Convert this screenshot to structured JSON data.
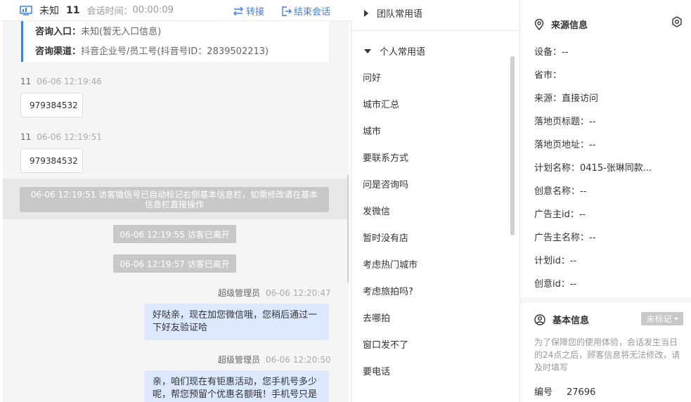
{
  "header": {
    "visitor_label": "未知",
    "visitor_num": "11",
    "timer_label": "会话时间：",
    "timer_value": "00:00:09",
    "transfer_label": "转接",
    "end_label": "结束会话"
  },
  "info_card": {
    "entry_label": "咨询入口：",
    "entry_value": "未知(暂无入口信息)",
    "channel_label": "咨询渠道：",
    "channel_value": "抖音企业号/员工号(抖音号ID：2839502213)"
  },
  "messages": [
    {
      "sender": "11",
      "time": "06-06 12:19:46",
      "text": "979384532"
    },
    {
      "sender": "11",
      "time": "06-06 12:19:51",
      "text": "979384532"
    }
  ],
  "system": {
    "wide": "06-06 12:19:51 访客微信号已自动标记右侧基本信息栏，如需修改请在基本信息栏直接操作",
    "leave1": "06-06 12:19:55 访客已离开",
    "leave2": "06-06 12:19:57 访客已离开"
  },
  "agent_messages": [
    {
      "sender": "超级管理员",
      "time": "06-06 12:20:47",
      "text": "好哒亲，现在加您微信哦，您稍后通过一下好友验证哈"
    },
    {
      "sender": "超级管理员",
      "time": "06-06 12:20:50",
      "text": "亲，咱们现在有钜惠活动，您手机号多少呢，帮您预留个优惠名额哦！手机号只是"
    }
  ],
  "phrases": {
    "team_group": "团队常用语",
    "personal_group": "个人常用语",
    "items": [
      "问好",
      "城市汇总",
      "城市",
      "要联系方式",
      "问是咨询吗",
      "发微信",
      "暂时没有店",
      "考虑热门城市",
      "考虑旅拍吗?",
      "去哪拍",
      "窗口发不了",
      "要电话"
    ]
  },
  "source_info": {
    "title": "来源信息",
    "fields": [
      "设备：--",
      "省市：",
      "来源：直接访问",
      "落地页标题：--",
      "落地页地址：--",
      "计划名称：0415-张琳同款...",
      "创意名称：--",
      "广告主id：--",
      "广告主名称：--",
      "计划id：--",
      "创意id：--"
    ]
  },
  "basic_info": {
    "title": "基本信息",
    "tag_label": "未标记",
    "notice": "为了保障您的使用体验，会话发生当日的24点之后，顾客信息将无法修改，请及时填写",
    "id_label": "编号",
    "id_value": "27696"
  }
}
